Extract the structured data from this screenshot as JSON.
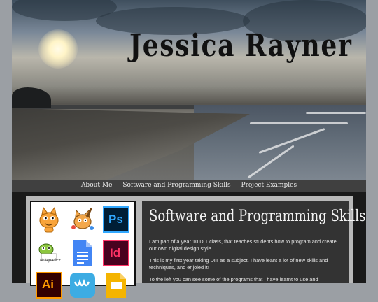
{
  "header": {
    "title": "Jessica Rayner"
  },
  "nav": {
    "items": [
      {
        "label": "About Me"
      },
      {
        "label": "Software and Programming Skills"
      },
      {
        "label": "Project Examples"
      }
    ]
  },
  "logos": [
    {
      "icon": "scratch-cat-icon"
    },
    {
      "icon": "paint-cat-icon"
    },
    {
      "icon": "photoshop-icon",
      "text": "Ps",
      "color": "#31a8ff",
      "bg": "#001e36"
    },
    {
      "icon": "notepad-plus-plus-icon",
      "text": "Notepad++"
    },
    {
      "icon": "google-docs-icon",
      "color": "#4285f4"
    },
    {
      "icon": "indesign-icon",
      "text": "Id",
      "color": "#ff3366",
      "bg": "#49021f"
    },
    {
      "icon": "illustrator-icon",
      "text": "Ai",
      "color": "#ff9a00",
      "bg": "#330000"
    },
    {
      "icon": "weebly-icon",
      "color": "#3dace3"
    },
    {
      "icon": "google-slides-icon",
      "color": "#f4b400"
    }
  ],
  "section": {
    "heading": "Software and Programming Skills",
    "paragraphs": [
      "I am part of a year 10 DIT class, that teaches students how to program and create our own digital design style.",
      "This is my first year taking DIT as a subject. I have leant a lot of new skills and techniques, and enjoied it!",
      "To the left you can see some of the programs that I have learnt to use and"
    ]
  }
}
